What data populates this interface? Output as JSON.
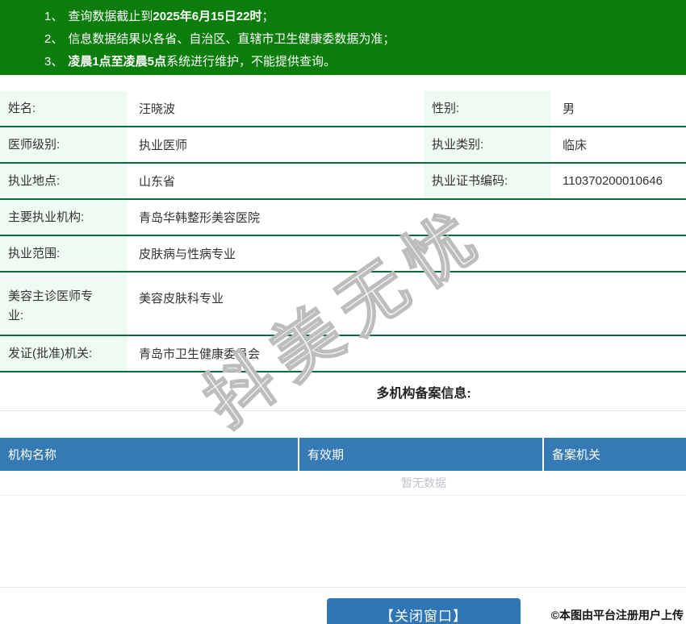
{
  "banner": {
    "notices": [
      {
        "num": "1、",
        "pre": "查询数据截止到",
        "bold": "2025年6月15日22时",
        "post": "；"
      },
      {
        "num": "2、",
        "pre": "信息数据结果以各省、自治区、直辖市卫生健康委数据为准；",
        "bold": "",
        "post": ""
      },
      {
        "num": "3、",
        "pre": "",
        "bold": "凌晨1点至凌晨5点",
        "post": "系统进行维护，不能提供查询。"
      }
    ]
  },
  "info": {
    "rows": [
      {
        "l1": "姓名:",
        "v1": "汪晓波",
        "l2": "性别:",
        "v2": "男"
      },
      {
        "l1": "医师级别:",
        "v1": "执业医师",
        "l2": "执业类别:",
        "v2": "临床"
      },
      {
        "l1": "执业地点:",
        "v1": "山东省",
        "l2": "执业证书编码:",
        "v2": "110370200010646"
      },
      {
        "l1": "主要执业机构:",
        "v1": "青岛华韩整形美容医院"
      },
      {
        "l1": "执业范围:",
        "v1": "皮肤病与性病专业"
      },
      {
        "l1": "美容主诊医师专业:",
        "v1": "美容皮肤科专业"
      },
      {
        "l1": "发证(批准)机关:",
        "v1": "青岛市卫生健康委员会"
      }
    ]
  },
  "filing": {
    "title": "多机构备案信息:",
    "columns": [
      "机构名称",
      "有效期",
      "备案机关"
    ],
    "empty_text": "暂无数据"
  },
  "footer": {
    "close_button": "【关闭窗口】"
  },
  "overlays": {
    "watermark": "抖美无忧",
    "attribution": "©本图由平台注册用户上传"
  },
  "colors": {
    "banner_green": "#0a7d0a",
    "row_border_green": "#0a6b3c",
    "label_bg_mint": "#effaf3",
    "table_header_blue": "#3579b5",
    "button_blue": "#3076b5",
    "empty_text_gray": "#bfc3cb"
  }
}
